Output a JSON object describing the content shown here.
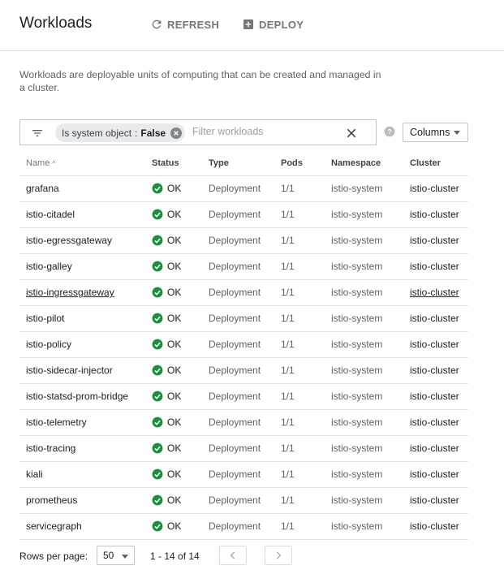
{
  "header": {
    "title": "Workloads",
    "refresh_label": "REFRESH",
    "deploy_label": "DEPLOY"
  },
  "description": "Workloads are deployable units of computing that can be created and managed in a cluster.",
  "filter": {
    "chip_key": "Is system object",
    "chip_sep": ":",
    "chip_value": "False",
    "placeholder": "Filter workloads"
  },
  "columns_button": "Columns",
  "table": {
    "headers": [
      "Name",
      "Status",
      "Type",
      "Pods",
      "Namespace",
      "Cluster"
    ],
    "sort_indicator": "^",
    "rows": [
      [
        "grafana",
        "OK",
        "Deployment",
        "1/1",
        "istio-system",
        "istio-cluster"
      ],
      [
        "istio-citadel",
        "OK",
        "Deployment",
        "1/1",
        "istio-system",
        "istio-cluster"
      ],
      [
        "istio-egressgateway",
        "OK",
        "Deployment",
        "1/1",
        "istio-system",
        "istio-cluster"
      ],
      [
        "istio-galley",
        "OK",
        "Deployment",
        "1/1",
        "istio-system",
        "istio-cluster"
      ],
      [
        "istio-ingressgateway",
        "OK",
        "Deployment",
        "1/1",
        "istio-system",
        "istio-cluster"
      ],
      [
        "istio-pilot",
        "OK",
        "Deployment",
        "1/1",
        "istio-system",
        "istio-cluster"
      ],
      [
        "istio-policy",
        "OK",
        "Deployment",
        "1/1",
        "istio-system",
        "istio-cluster"
      ],
      [
        "istio-sidecar-injector",
        "OK",
        "Deployment",
        "1/1",
        "istio-system",
        "istio-cluster"
      ],
      [
        "istio-statsd-prom-bridge",
        "OK",
        "Deployment",
        "1/1",
        "istio-system",
        "istio-cluster"
      ],
      [
        "istio-telemetry",
        "OK",
        "Deployment",
        "1/1",
        "istio-system",
        "istio-cluster"
      ],
      [
        "istio-tracing",
        "OK",
        "Deployment",
        "1/1",
        "istio-system",
        "istio-cluster"
      ],
      [
        "kiali",
        "OK",
        "Deployment",
        "1/1",
        "istio-system",
        "istio-cluster"
      ],
      [
        "prometheus",
        "OK",
        "Deployment",
        "1/1",
        "istio-system",
        "istio-cluster"
      ],
      [
        "servicegraph",
        "OK",
        "Deployment",
        "1/1",
        "istio-system",
        "istio-cluster"
      ]
    ]
  },
  "pagination": {
    "rows_per_page_label": "Rows per page:",
    "rows_per_page_value": "50",
    "range": "1 - 14 of 14"
  },
  "colors": {
    "ok_green": "#1e8e3e",
    "border": "#e0e0e0"
  },
  "icons": [
    "refresh-icon",
    "add-box-icon",
    "filter-list-icon",
    "chip-close-icon",
    "clear-icon",
    "help-icon",
    "check-circle-icon",
    "chevron-left-icon",
    "chevron-right-icon"
  ]
}
